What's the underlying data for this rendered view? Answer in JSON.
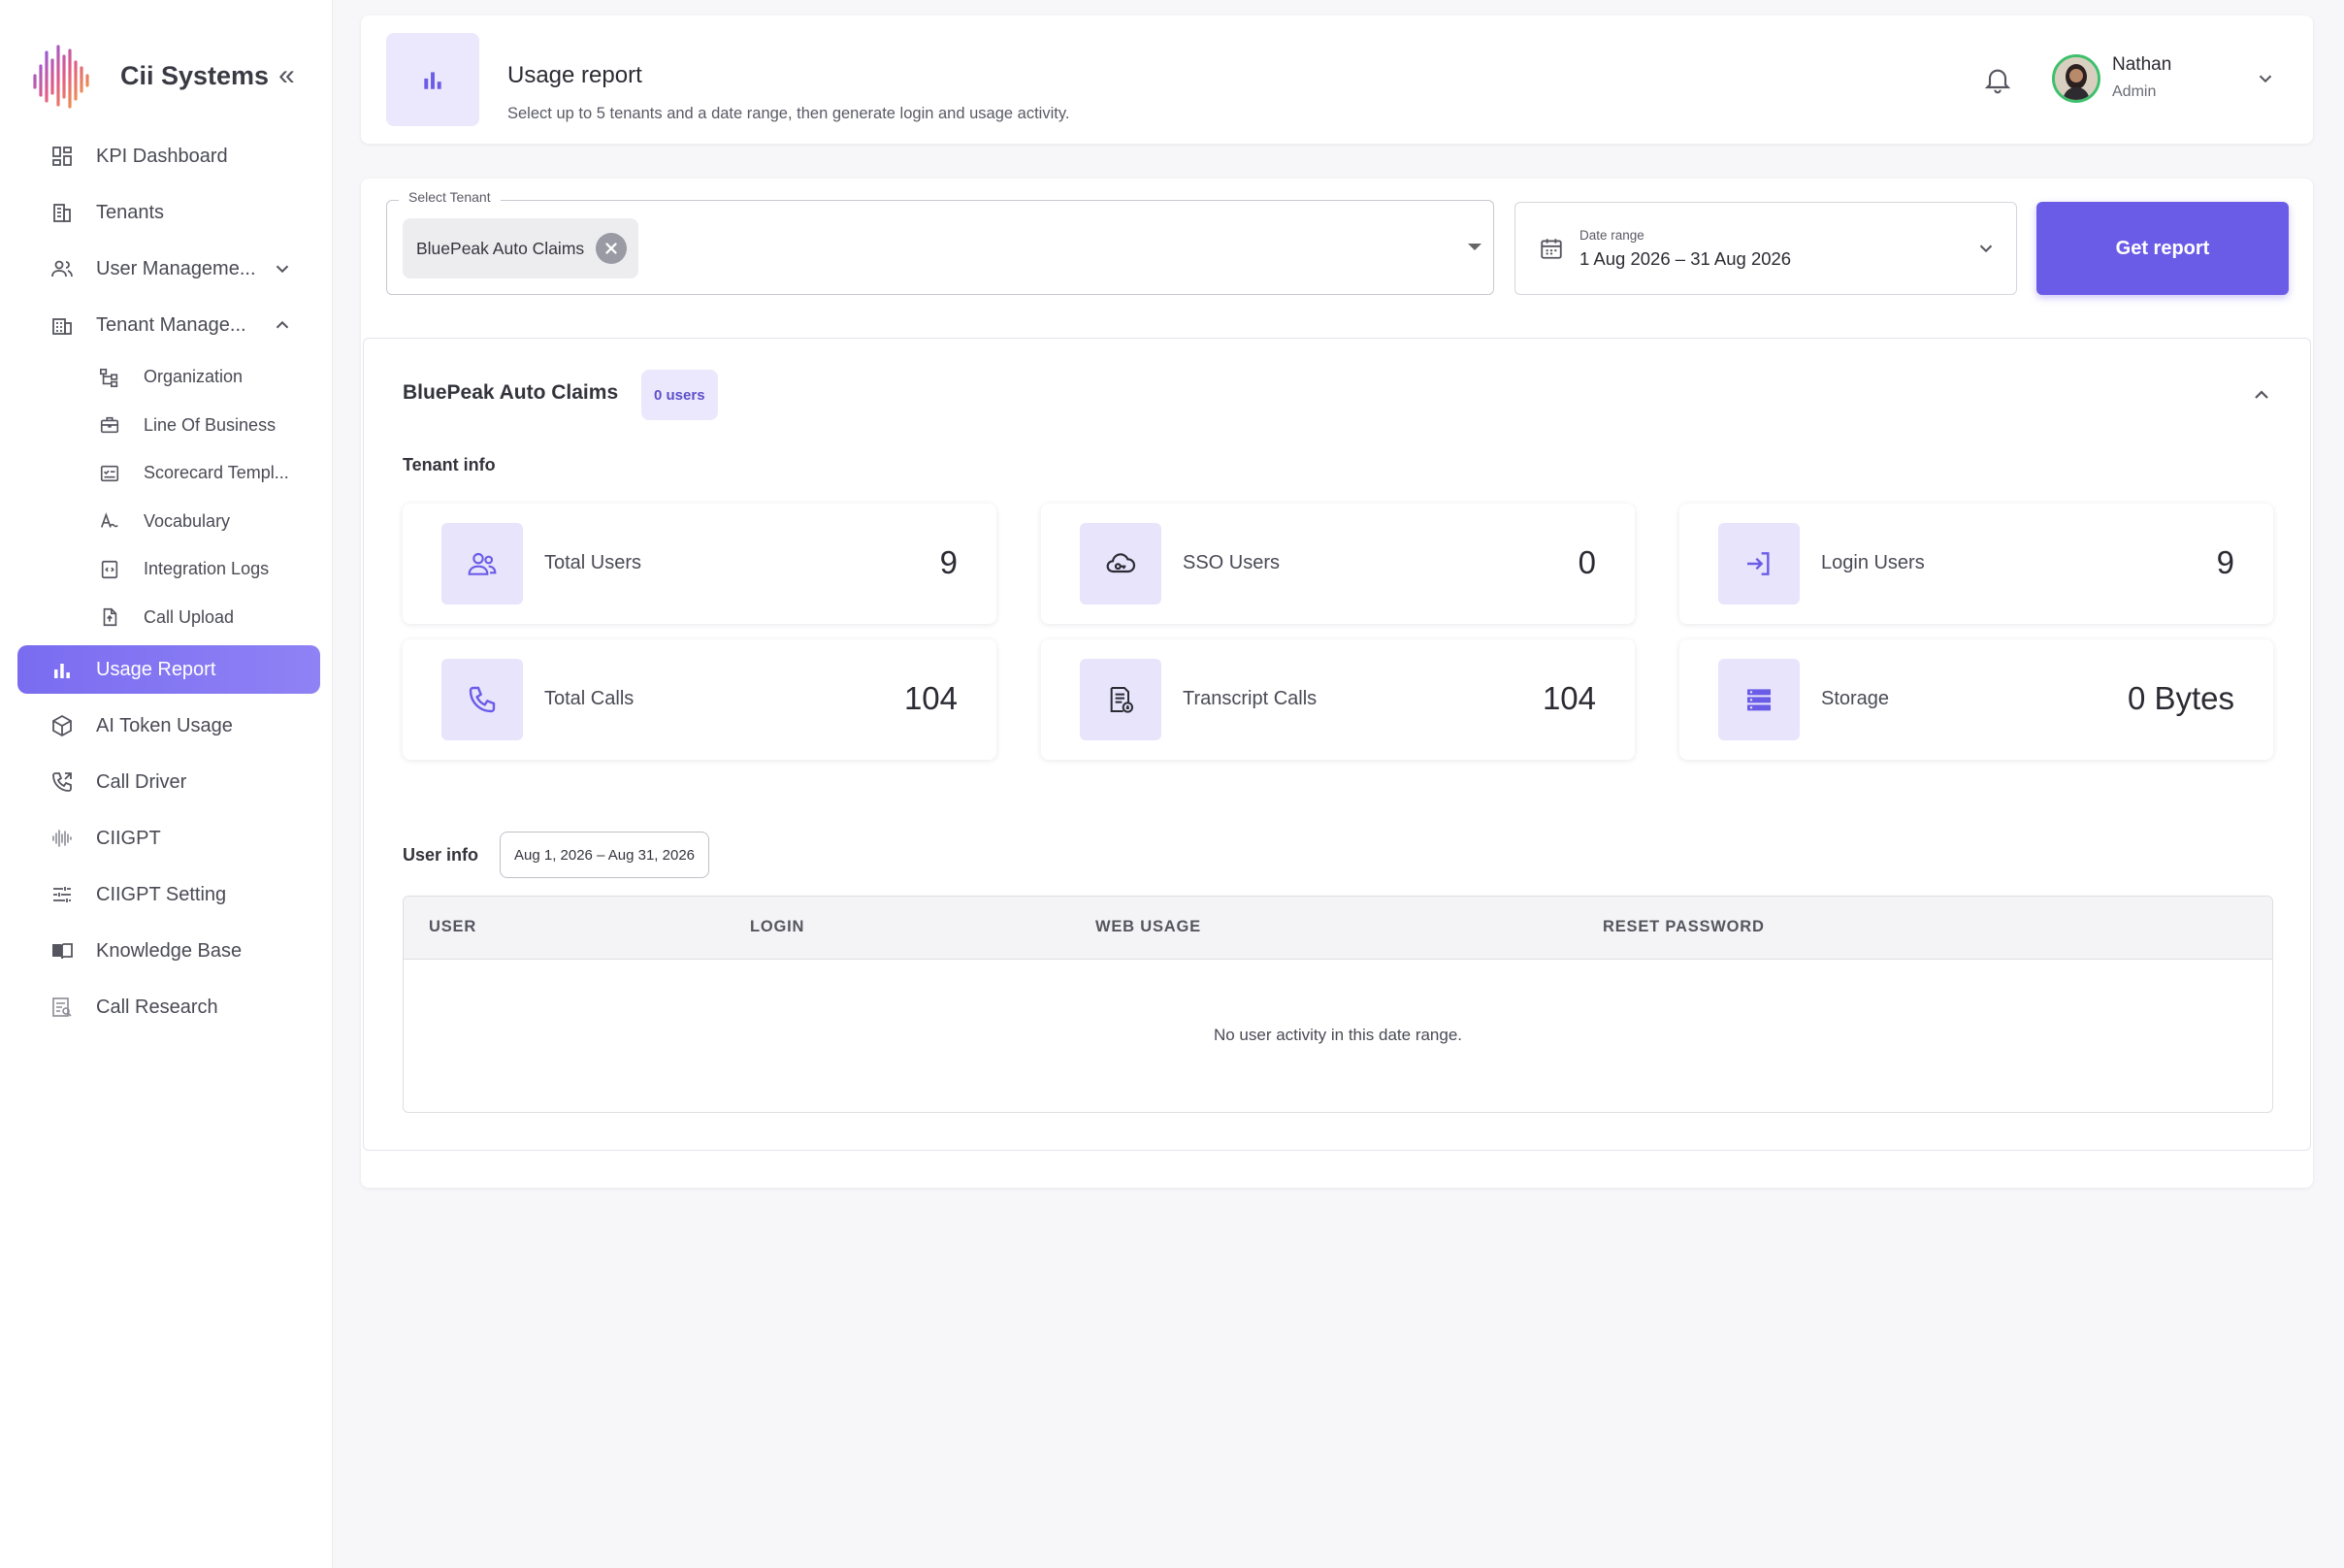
{
  "brand": {
    "name": "Cii Systems",
    "collapse_glyph": "«"
  },
  "sidebar": {
    "items": [
      {
        "label": "KPI Dashboard",
        "icon": "dashboard-icon"
      },
      {
        "label": "Tenants",
        "icon": "building-icon"
      },
      {
        "label": "User Manageme...",
        "icon": "users-icon",
        "expandable": true,
        "expanded": false
      },
      {
        "label": "Tenant Manage...",
        "icon": "tenant-icon",
        "expandable": true,
        "expanded": true
      },
      {
        "label": "Usage Report",
        "icon": "bar-chart-icon",
        "active": true
      },
      {
        "label": "AI Token Usage",
        "icon": "cube-icon"
      },
      {
        "label": "Call Driver",
        "icon": "phone-icon"
      },
      {
        "label": "CIIGPT",
        "icon": "soundwave-icon"
      },
      {
        "label": "CIIGPT Setting",
        "icon": "sliders-icon"
      },
      {
        "label": "Knowledge Base",
        "icon": "book-icon"
      },
      {
        "label": "Call Research",
        "icon": "research-icon"
      }
    ],
    "sub_items": [
      {
        "label": "Organization",
        "icon": "org-chart-icon"
      },
      {
        "label": "Line Of Business",
        "icon": "briefcase-icon"
      },
      {
        "label": "Scorecard Templ...",
        "icon": "scorecard-icon"
      },
      {
        "label": "Vocabulary",
        "icon": "vocabulary-icon"
      },
      {
        "label": "Integration Logs",
        "icon": "code-file-icon"
      },
      {
        "label": "Call Upload",
        "icon": "upload-file-icon"
      }
    ]
  },
  "header": {
    "title": "Usage report",
    "subtitle": "Select up to 5 tenants and a date range, then generate login and usage activity.",
    "user": {
      "name": "Nathan",
      "role": "Admin"
    }
  },
  "filters": {
    "tenant_label": "Select Tenant",
    "selected_tenant": "BluePeak Auto Claims",
    "date_label": "Date range",
    "date_value": "1 Aug 2026 – 31 Aug 2026",
    "button_label": "Get report"
  },
  "tenant": {
    "name": "BluePeak Auto Claims",
    "badge": "0 users",
    "info_title": "Tenant info",
    "stats": [
      {
        "label": "Total Users",
        "value": "9",
        "icon": "users-icon"
      },
      {
        "label": "SSO Users",
        "value": "0",
        "icon": "cloud-key-icon"
      },
      {
        "label": "Login Users",
        "value": "9",
        "icon": "login-icon"
      },
      {
        "label": "Total Calls",
        "value": "104",
        "icon": "phone-icon"
      },
      {
        "label": "Transcript Calls",
        "value": "104",
        "icon": "transcript-icon"
      },
      {
        "label": "Storage",
        "value": "0 Bytes",
        "icon": "storage-icon"
      }
    ],
    "user_info": {
      "title": "User info",
      "range": "Aug 1, 2026 – Aug 31, 2026",
      "columns": [
        "USER",
        "LOGIN",
        "WEB USAGE",
        "RESET PASSWORD"
      ],
      "empty_text": "No user activity in this date range."
    }
  },
  "colors": {
    "accent": "#6b5ce7",
    "accent_light": "#ebe8fd",
    "background": "#f7f7f9"
  }
}
